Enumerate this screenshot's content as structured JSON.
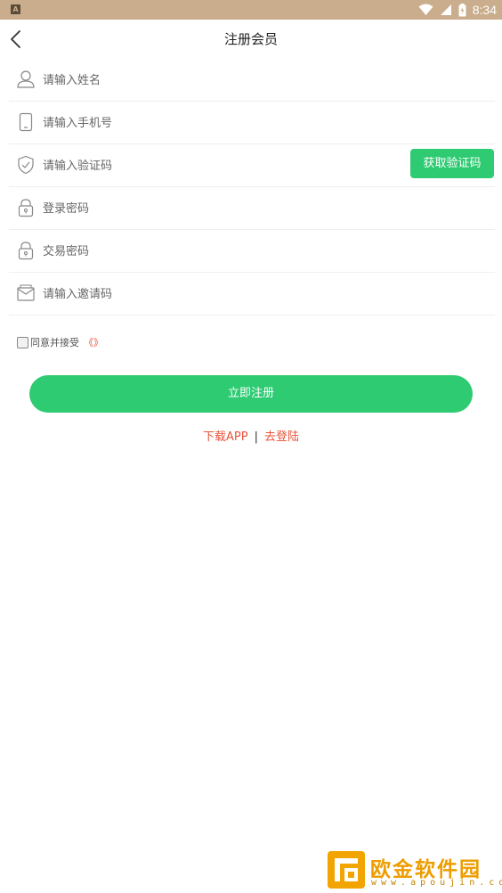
{
  "status_bar": {
    "indicator": "A",
    "time": "8:34",
    "icons": [
      "wifi-icon",
      "signal-icon",
      "battery-icon"
    ]
  },
  "header": {
    "title": "注册会员",
    "back_icon": "chevron-left-icon"
  },
  "form": {
    "name_placeholder": "请输入姓名",
    "phone_placeholder": "请输入手机号",
    "code_placeholder": "请输入验证码",
    "get_code_label": "获取验证码",
    "login_password_placeholder": "登录密码",
    "trade_password_placeholder": "交易密码",
    "invite_placeholder": "请输入邀请码"
  },
  "agreement": {
    "text": "同意并接受",
    "link": "《》"
  },
  "submit_label": "立即注册",
  "links": {
    "download": "下载APP",
    "separator": "|",
    "login": "去登陆"
  },
  "watermark": {
    "name": "欧金软件园",
    "url": "www.apoujin.com"
  },
  "colors": {
    "status_bar": "#c9ad8c",
    "accent_green": "#2ecb72",
    "link_red": "#e8543a",
    "watermark": "#ed9d00"
  }
}
